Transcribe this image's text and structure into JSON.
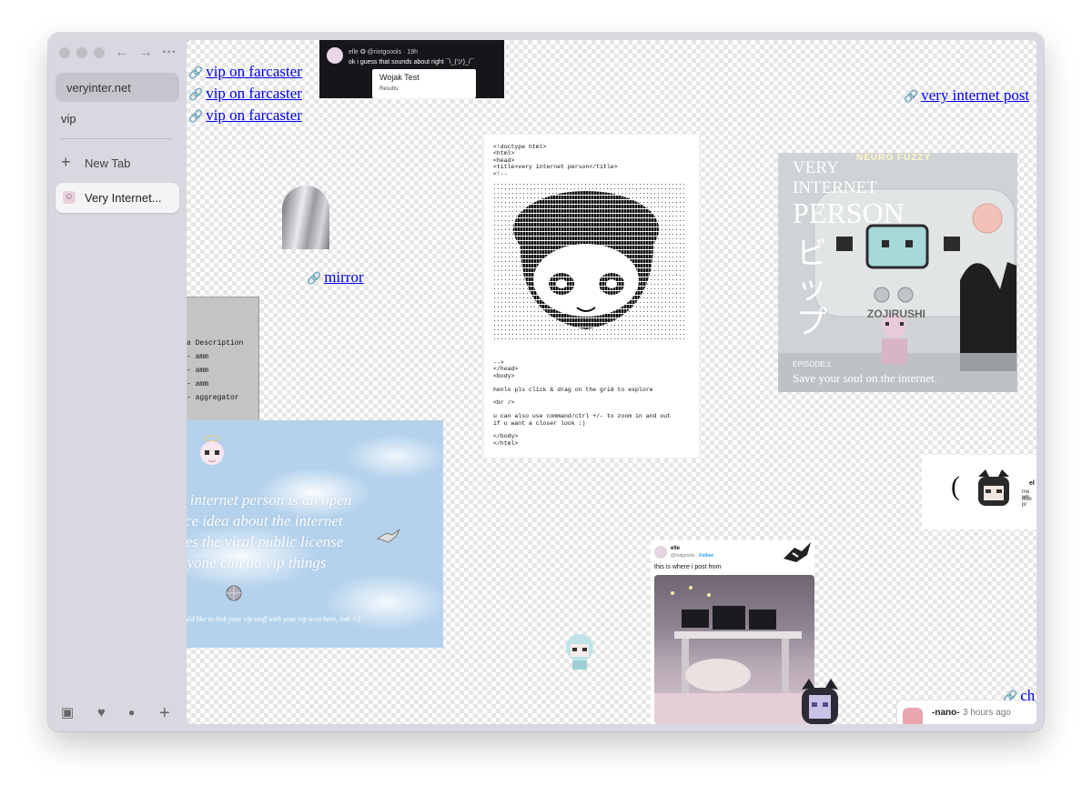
{
  "browser": {
    "url": "veryinter.net",
    "space_label": "vip",
    "new_tab_label": "New Tab",
    "active_tab_title": "Very Internet...",
    "nav_back_icon": "arrow-left-icon",
    "nav_forward_icon": "arrow-right-icon",
    "more_icon": "ellipsis-icon",
    "bottom_icons": [
      "archive-icon",
      "heart-icon",
      "dot-icon",
      "plus-icon"
    ]
  },
  "canvas": {
    "links": {
      "farcaster_1": "vip on farcaster",
      "farcaster_2": "vip on farcaster",
      "farcaster_3": "vip on farcaster",
      "mirror": "mirror",
      "post": "very internet post",
      "partial": "ch"
    },
    "tweet_top": {
      "handle": "elle ✪ @riotgoools · 19h",
      "text": "ok i guess that sounds about right ¯\\_(ツ)_/¯",
      "card_title": "Wojak Test",
      "card_subtitle": "Results:"
    },
    "table_card": {
      "header": "a  Description",
      "rows": [
        "-  amm",
        "-  amm",
        "-  amm",
        "-  aggregator"
      ]
    },
    "sky_card": {
      "lines": [
        "y internet person is an open",
        "rce idea about the internet",
        "ses the viral public license",
        "nyone can do vip things"
      ],
      "small": "uld like to link your vip stuff with your vip icon here, imk <3"
    },
    "code_card": {
      "head_lines": "<!doctype html>\n<html>\n<head>\n<title>very internet person</title>\n<!--",
      "tail_lines": "-->\n</head>\n<body>\n\nhenlo pls click & drag on the grid to explore\n\n<br />\n\nu can also use command/ctrl +/- to zoom in and out\nif u want a closer look :)\n\n</body>\n</html>"
    },
    "vip_card": {
      "brand": "NEURO FUZZY",
      "line1": "VERY",
      "line2": "INTERNET",
      "line3": "PERSON",
      "katakana": "ビップ",
      "maker": "ZOJIRUSHI",
      "episode": "EPISODE:1",
      "tagline": "Save your soul on the internet."
    },
    "fragment_card": {
      "paren": "(",
      "text1": "el",
      "text2": "me wh",
      "text3": "little pr"
    },
    "tweet_bottom": {
      "name": "elle",
      "handle": "@riotgoools",
      "follow": "Follow",
      "text": "this is where i post from"
    },
    "notification": {
      "name": "-nano-",
      "time": "3 hours ago"
    }
  }
}
